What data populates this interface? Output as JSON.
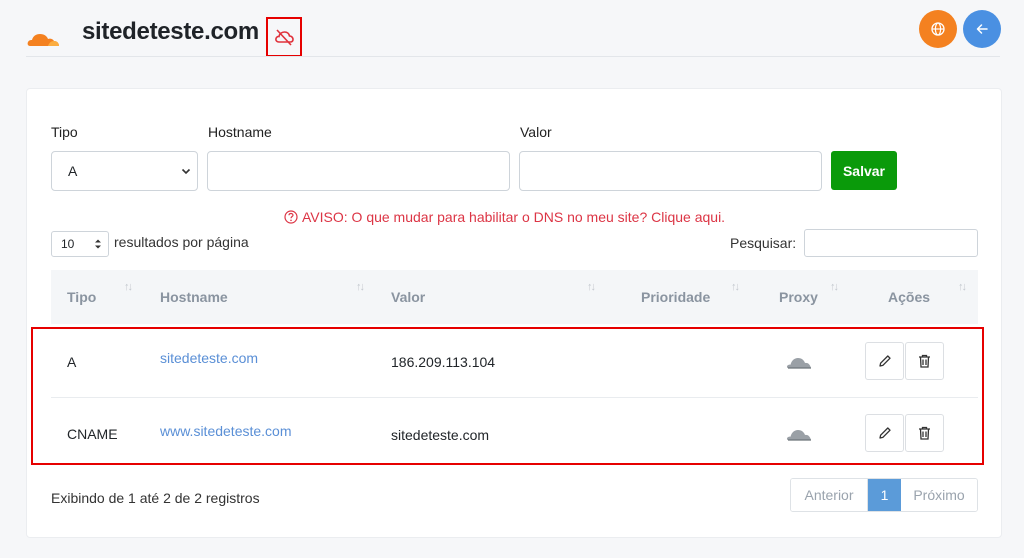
{
  "header": {
    "site_title": "sitedeteste.com",
    "brand_color": "#f48120",
    "cloud_status_icon": "cloud-off-icon",
    "globe_icon": "globe-icon",
    "back_icon": "arrow-left-icon"
  },
  "form": {
    "type_label": "Tipo",
    "type_value": "A",
    "hostname_label": "Hostname",
    "hostname_value": "",
    "value_label": "Valor",
    "value_value": "",
    "save_label": "Salvar"
  },
  "warning": {
    "text": "AVISO: O que mudar para habilitar o DNS no meu site? Clique aqui.",
    "color": "#dc3545"
  },
  "table_controls": {
    "per_page_value": "10",
    "per_page_label": "resultados por página",
    "search_label": "Pesquisar:",
    "search_value": ""
  },
  "table": {
    "columns": [
      "Tipo",
      "Hostname",
      "Valor",
      "Prioridade",
      "Proxy",
      "Ações"
    ],
    "rows": [
      {
        "tipo": "A",
        "hostname": "sitedeteste.com",
        "valor": "186.209.113.104",
        "prioridade": "",
        "proxy_icon": "cloud-disabled-icon"
      },
      {
        "tipo": "CNAME",
        "hostname": "www.sitedeteste.com",
        "valor": "sitedeteste.com",
        "prioridade": "",
        "proxy_icon": "cloud-disabled-icon"
      }
    ]
  },
  "footer": {
    "info": "Exibindo de 1 até 2 de 2 registros",
    "prev_label": "Anterior",
    "page_label": "1",
    "next_label": "Próximo"
  }
}
